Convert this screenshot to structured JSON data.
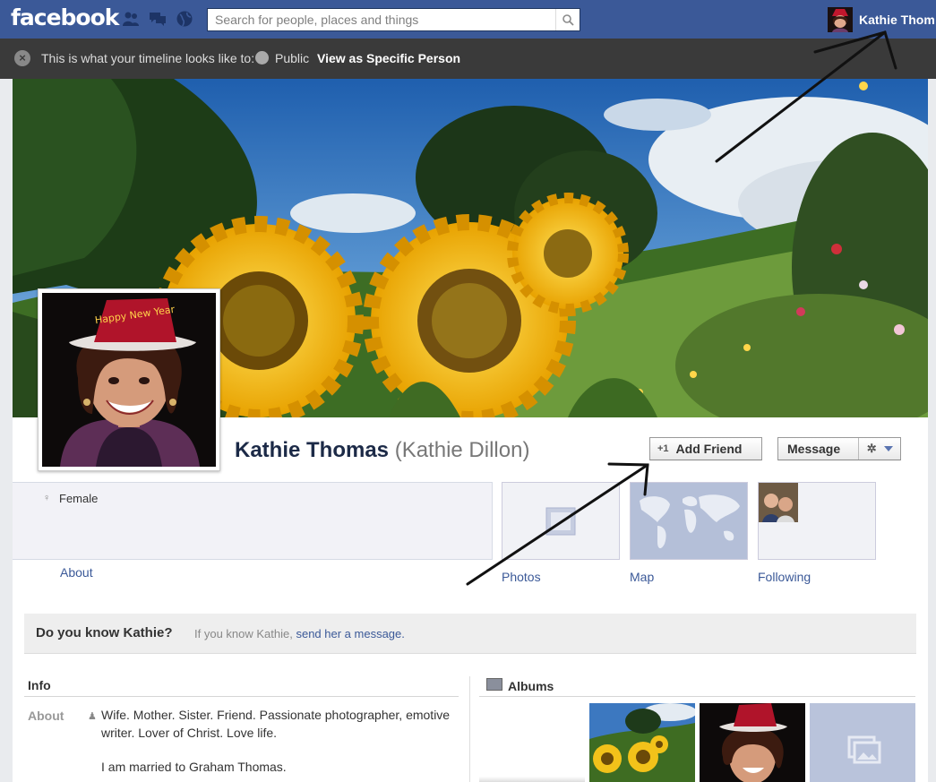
{
  "topbar": {
    "logo": "facebook",
    "search_placeholder": "Search for people, places and things",
    "user_name": "Kathie Thom",
    "brand_color": "#3b5998"
  },
  "viewbar": {
    "message": "This is what your timeline looks like to:",
    "audience": "Public",
    "view_as": "View as Specific Person"
  },
  "profile": {
    "name": "Kathie Thomas",
    "alt_name": "(Kathie Dillon)",
    "hat_text": "Happy New Year",
    "add_friend": "Add Friend",
    "message": "Message",
    "sex": "Female",
    "about_link": "About"
  },
  "apps": [
    {
      "label": "Photos"
    },
    {
      "label": "Map"
    },
    {
      "label": "Following"
    }
  ],
  "know": {
    "title": "Do you know Kathie?",
    "text": "If you know Kathie,",
    "link": "send her a message."
  },
  "info": {
    "heading": "Info",
    "about_key": "About",
    "about_text": "Wife. Mother. Sister. Friend. Passionate photographer, emotive writer. Lover of Christ. Love life.",
    "married": "I am married to Graham Thomas."
  },
  "albums": {
    "heading": "Albums"
  }
}
